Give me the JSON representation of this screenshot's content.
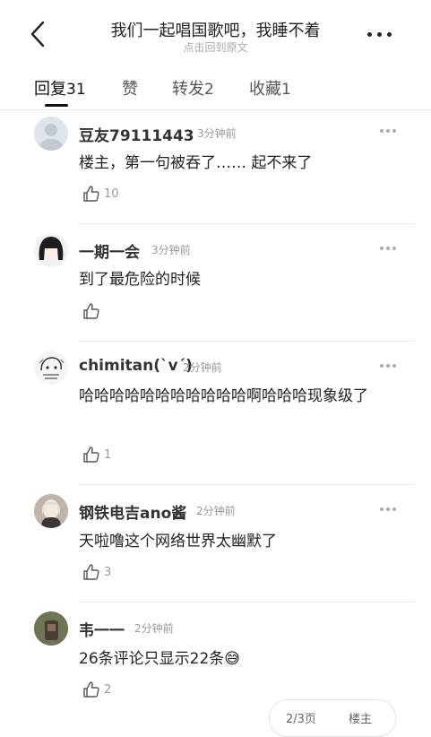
{
  "header": {
    "title": "我们一起唱国歌吧，我睡不着",
    "subtitle": "点击回到原文"
  },
  "tabs": [
    {
      "label": "回复",
      "count": "31"
    },
    {
      "label": "赞",
      "count": ""
    },
    {
      "label": "转发",
      "count": "2"
    },
    {
      "label": "收藏",
      "count": "1"
    }
  ],
  "comments": [
    {
      "name": "豆友79111443",
      "time": "3分钟前",
      "text": "楼主，第一句被吞了…… 起不来了",
      "likes": "10"
    },
    {
      "name": "一期一会",
      "time": "3分钟前",
      "text": "到了最危险的时候",
      "likes": ""
    },
    {
      "name": "chimitan(`v´)",
      "time": "2分钟前",
      "text": "哈哈哈哈哈哈哈哈哈哈哈啊哈哈哈现象级了",
      "likes": "1"
    },
    {
      "name": "钢铁电吉ano酱",
      "time": "2分钟前",
      "text": "天啦噜这个网络世界太幽默了",
      "likes": "3"
    },
    {
      "name": "韦一一",
      "time": "2分钟前",
      "text": "26条评论只显示22条😅",
      "likes": "2"
    }
  ],
  "footer": {
    "page": "2/3页",
    "sort": "楼主"
  },
  "icons": {
    "back": "chevron-left-icon",
    "more": "more-horizontal-icon",
    "like": "thumbs-up-icon"
  }
}
